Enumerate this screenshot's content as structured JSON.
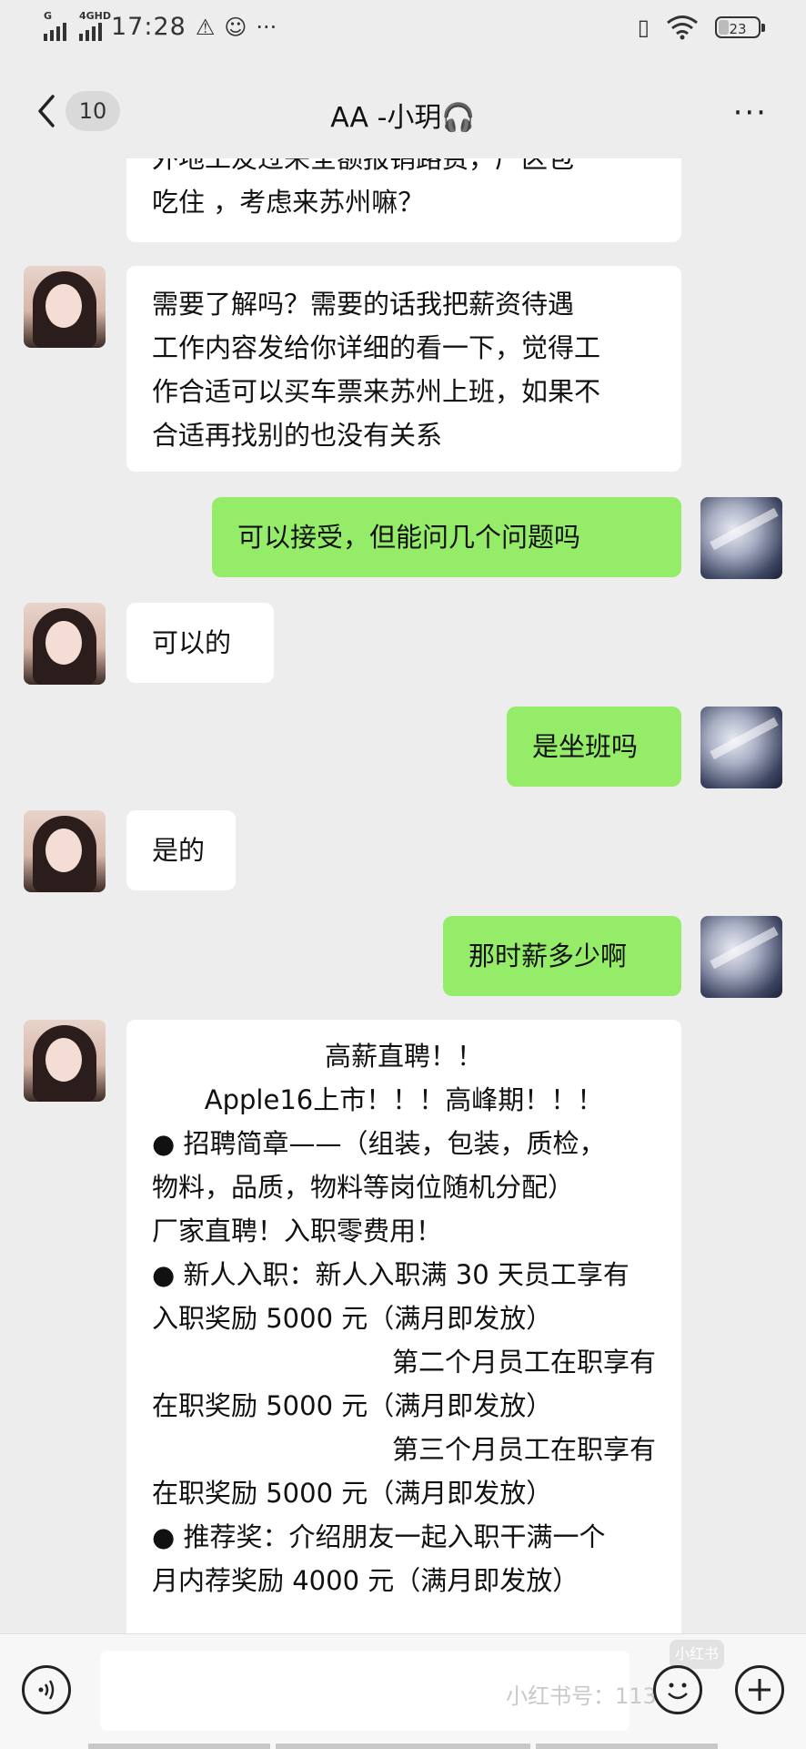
{
  "status_bar": {
    "signal1_label": "G",
    "signal2_label": "4GHD",
    "time": "17:28",
    "battery_level": "23"
  },
  "nav": {
    "unread_count": "10",
    "title": "AA -小玥🎧"
  },
  "messages": [
    {
      "from": "contact",
      "lines": [
        "外地工友过来全额报销路费，厂区包",
        "吃住 ，考虑来苏州嘛？"
      ]
    },
    {
      "from": "contact",
      "lines": [
        "需要了解吗？需要的话我把薪资待遇",
        "工作内容发给你详细的看一下，觉得工",
        "作合适可以买车票来苏州上班，如果不",
        "合适再找别的也没有关系"
      ]
    },
    {
      "from": "me",
      "lines": [
        "可以接受，但能问几个问题吗"
      ]
    },
    {
      "from": "contact",
      "lines": [
        "可以的"
      ]
    },
    {
      "from": "me",
      "lines": [
        "是坐班吗"
      ]
    },
    {
      "from": "contact",
      "lines": [
        "是的"
      ]
    },
    {
      "from": "me",
      "lines": [
        "那时薪多少啊"
      ]
    },
    {
      "from": "contact",
      "lines": [
        "高薪直聘！！",
        "Apple16上市！！！高峰期！！！",
        "● 招聘简章——（组装，包装，质检，",
        "物料，品质，物料等岗位随机分配）",
        "厂家直聘！入职零费用！",
        "● 新人入职：新人入职满 30 天员工享有",
        "入职奖励 5000 元（满月即发放）",
        "第二个月员工在职享有",
        "在职奖励 5000 元（满月即发放）",
        "第三个月员工在职享有",
        "在职奖励 5000 元（满月即发放）",
        "● 推荐奖：介绍朋友一起入职干满一个",
        "月内荐奖励 4000 元（满月即发放）"
      ]
    }
  ],
  "input_bar": {
    "watermark": "小红书号：113",
    "watermark_logo": "小红书"
  },
  "icons": {
    "back": "chevron-left-icon",
    "more": "more-dots-icon",
    "voice": "voice-icon",
    "emoji": "emoji-icon",
    "plus": "plus-icon"
  },
  "colors": {
    "background": "#ededed",
    "incoming_bubble": "#ffffff",
    "outgoing_bubble": "#95ec69"
  }
}
